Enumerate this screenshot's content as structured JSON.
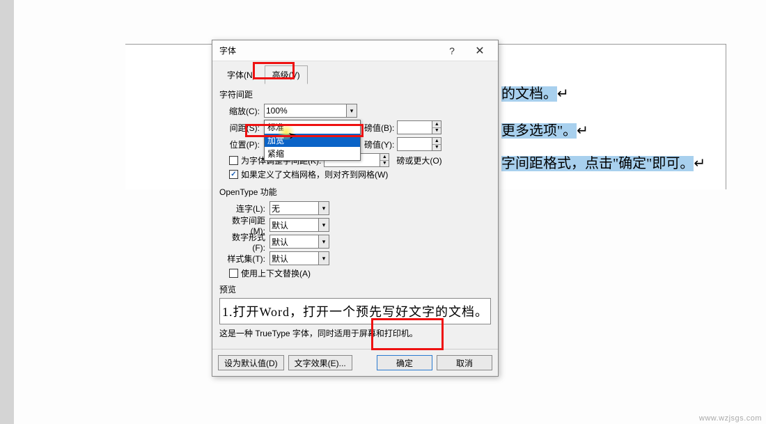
{
  "watermark": "www.wzjsgs.com",
  "doc_lines": {
    "l1": "的文档。",
    "l2": "更多选项\"。",
    "l3": "字间距格式，点击\"确定\"即可。"
  },
  "dialog": {
    "title": "字体",
    "help": "?",
    "close": "✕",
    "tabs": {
      "font": "字体(N)",
      "advanced": "高级(V)"
    },
    "char_spacing": {
      "group": "字符间距",
      "scale_label": "缩放(C):",
      "scale_value": "100%",
      "spacing_label": "间距(S):",
      "spacing_value": "标准",
      "spacing_pt_label": "磅值(B):",
      "spacing_pt_value": "",
      "position_label": "位置(P):",
      "position_value": "标准",
      "position_pt_label": "磅值(Y):",
      "position_pt_value": "",
      "kerning_chk": "为字体调整字间距(K):",
      "kerning_value": "",
      "kerning_unit": "磅或更大(O)",
      "grid_chk": "如果定义了文档网格，则对齐到网格(W)",
      "dropdown_options": [
        "标准",
        "加宽",
        "紧缩"
      ]
    },
    "opentype": {
      "group": "OpenType 功能",
      "ligatures_label": "连字(L):",
      "ligatures_value": "无",
      "numspacing_label": "数字间距(M):",
      "numspacing_value": "默认",
      "numforms_label": "数字形式(F):",
      "numforms_value": "默认",
      "styleset_label": "样式集(T):",
      "styleset_value": "默认",
      "context_chk": "使用上下文替换(A)"
    },
    "preview": {
      "group": "预览",
      "text": "1.打开Word，打开一个预先写好文字的文档。",
      "desc": "这是一种 TrueType 字体，同时适用于屏幕和打印机。"
    },
    "footer": {
      "default": "设为默认值(D)",
      "texteffect": "文字效果(E)...",
      "ok": "确定",
      "cancel": "取消"
    }
  }
}
